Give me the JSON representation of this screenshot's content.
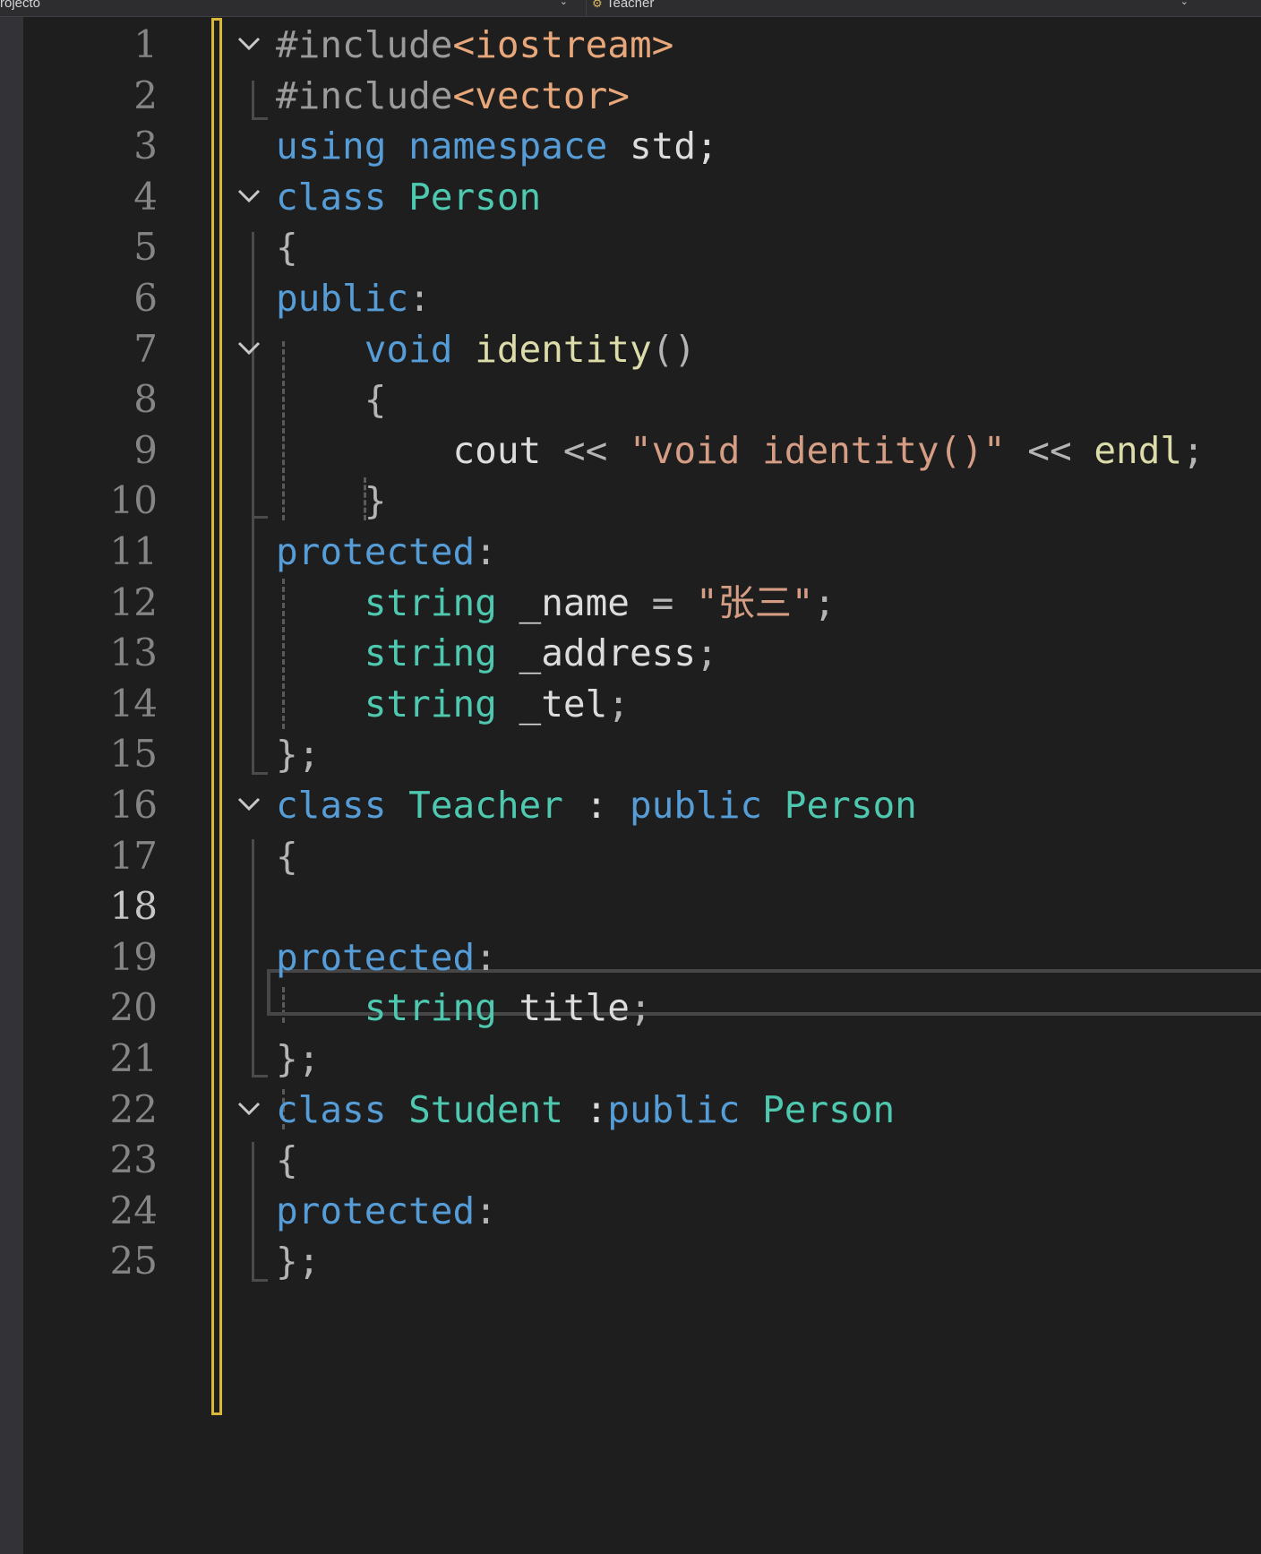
{
  "nav": {
    "project": "rojecto",
    "class_icon": "class-icon",
    "class_name": "Teacher",
    "caret": "⌄"
  },
  "editor": {
    "current_line": 18,
    "change_bar_color": "#d8b73a",
    "line_numbers": [
      "1",
      "2",
      "3",
      "4",
      "5",
      "6",
      "7",
      "8",
      "9",
      "10",
      "11",
      "12",
      "13",
      "14",
      "15",
      "16",
      "17",
      "18",
      "19",
      "20",
      "21",
      "22",
      "23",
      "24",
      "25"
    ],
    "lines": [
      [
        [
          "pre",
          "#include"
        ],
        [
          "inc",
          "<iostream>"
        ]
      ],
      [
        [
          "pre",
          "#include"
        ],
        [
          "inc",
          "<vector>"
        ]
      ],
      [
        [
          "kw",
          "using"
        ],
        [
          "plain",
          " "
        ],
        [
          "kw",
          "namespace"
        ],
        [
          "plain",
          " std;"
        ]
      ],
      [
        [
          "kw",
          "class"
        ],
        [
          "plain",
          " "
        ],
        [
          "type",
          "Person"
        ]
      ],
      [
        [
          "punct",
          "{"
        ]
      ],
      [
        [
          "kw",
          "public"
        ],
        [
          "punct",
          ":"
        ]
      ],
      [
        [
          "plain",
          "    "
        ],
        [
          "kw",
          "void"
        ],
        [
          "plain",
          " "
        ],
        [
          "fn",
          "identity"
        ],
        [
          "punct",
          "()"
        ]
      ],
      [
        [
          "plain",
          "    "
        ],
        [
          "punct",
          "{"
        ]
      ],
      [
        [
          "plain",
          "        cout "
        ],
        [
          "punct",
          "<<"
        ],
        [
          "plain",
          " "
        ],
        [
          "str",
          "\"void identity()\""
        ],
        [
          "plain",
          " "
        ],
        [
          "punct",
          "<<"
        ],
        [
          "plain",
          " "
        ],
        [
          "fn",
          "endl"
        ],
        [
          "punct",
          ";"
        ]
      ],
      [
        [
          "plain",
          "    "
        ],
        [
          "punct",
          "}"
        ]
      ],
      [
        [
          "kw",
          "protected"
        ],
        [
          "punct",
          ":"
        ]
      ],
      [
        [
          "plain",
          "    "
        ],
        [
          "type",
          "string"
        ],
        [
          "plain",
          " _name "
        ],
        [
          "punct",
          "="
        ],
        [
          "plain",
          " "
        ],
        [
          "str",
          "\"张三\""
        ],
        [
          "punct",
          ";"
        ]
      ],
      [
        [
          "plain",
          "    "
        ],
        [
          "type",
          "string"
        ],
        [
          "plain",
          " _address"
        ],
        [
          "punct",
          ";"
        ]
      ],
      [
        [
          "plain",
          "    "
        ],
        [
          "type",
          "string"
        ],
        [
          "plain",
          " _tel"
        ],
        [
          "punct",
          ";"
        ]
      ],
      [
        [
          "punct",
          "};"
        ]
      ],
      [
        [
          "kw",
          "class"
        ],
        [
          "plain",
          " "
        ],
        [
          "type",
          "Teacher"
        ],
        [
          "plain",
          " : "
        ],
        [
          "kw",
          "public"
        ],
        [
          "plain",
          " "
        ],
        [
          "type",
          "Person"
        ]
      ],
      [
        [
          "punct",
          "{"
        ]
      ],
      [],
      [
        [
          "kw",
          "protected"
        ],
        [
          "punct",
          ":"
        ]
      ],
      [
        [
          "plain",
          "    "
        ],
        [
          "type",
          "string"
        ],
        [
          "plain",
          " title"
        ],
        [
          "punct",
          ";"
        ]
      ],
      [
        [
          "punct",
          "};"
        ]
      ],
      [
        [
          "kw",
          "class"
        ],
        [
          "plain",
          " "
        ],
        [
          "type",
          "Student"
        ],
        [
          "plain",
          " :"
        ],
        [
          "kw",
          "public"
        ],
        [
          "plain",
          " "
        ],
        [
          "type",
          "Person"
        ]
      ],
      [
        [
          "punct",
          "{"
        ]
      ],
      [
        [
          "kw",
          "protected"
        ],
        [
          "punct",
          ":"
        ]
      ],
      [
        [
          "punct",
          "};"
        ]
      ]
    ],
    "fold_lines": [
      1,
      4,
      7,
      16,
      22
    ]
  }
}
